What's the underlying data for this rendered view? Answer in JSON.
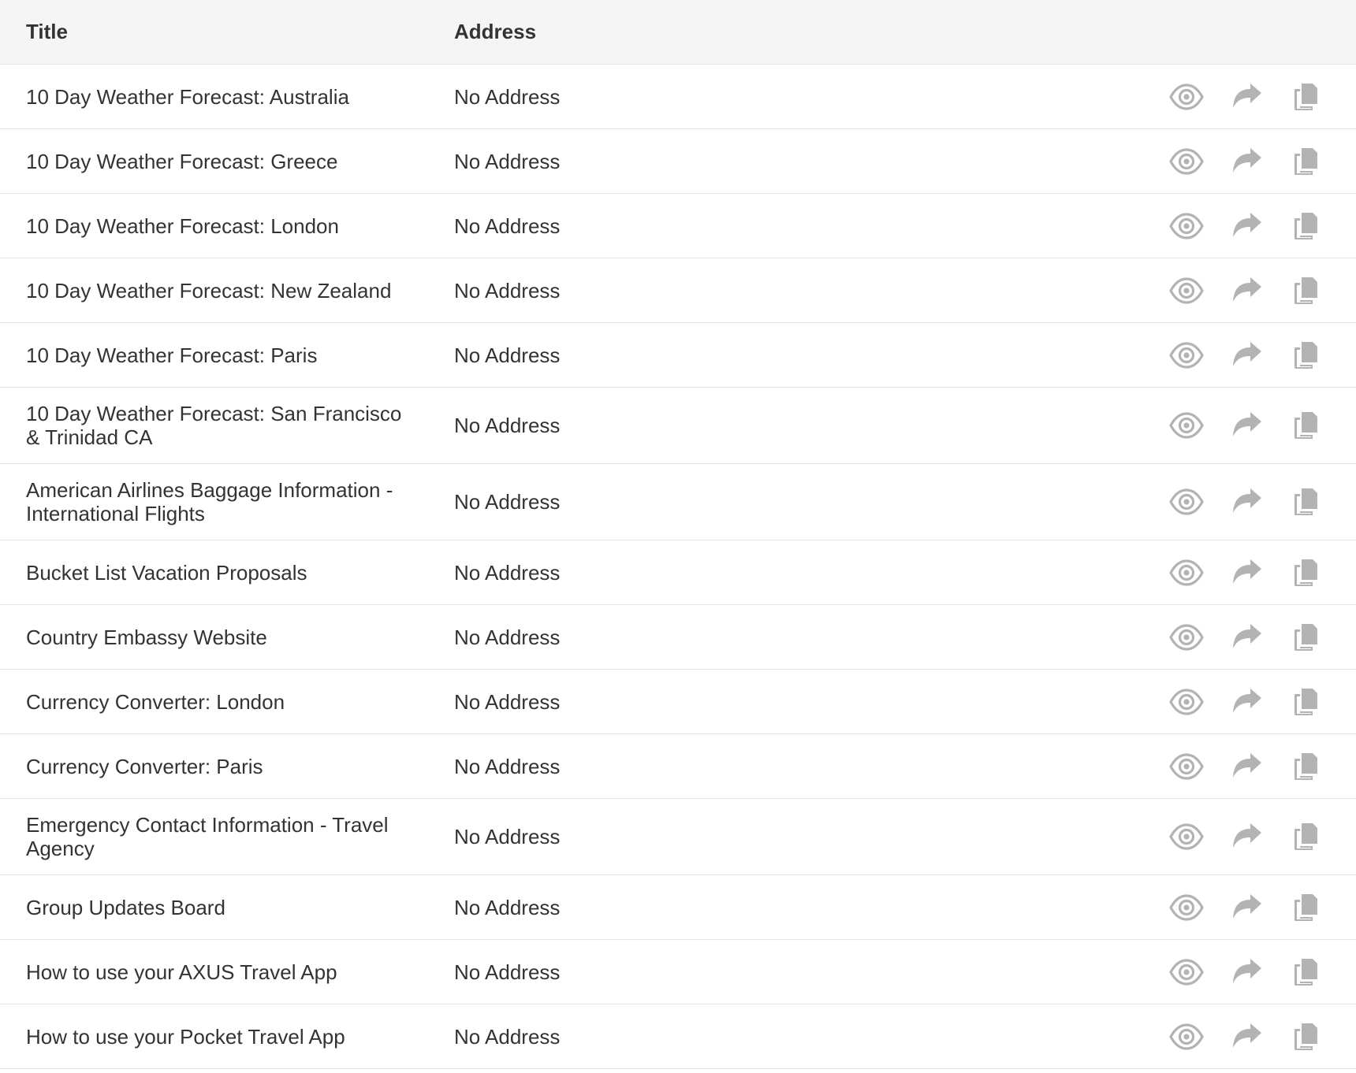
{
  "table": {
    "headers": {
      "title": "Title",
      "address": "Address"
    },
    "icon_color": "#b3b3b3",
    "row_actions": [
      "eye-icon",
      "share-icon",
      "copy-icon"
    ],
    "rows": [
      {
        "title": "10 Day Weather Forecast: Australia",
        "address": "No Address"
      },
      {
        "title": "10 Day Weather Forecast: Greece",
        "address": "No Address"
      },
      {
        "title": "10 Day Weather Forecast: London",
        "address": "No Address"
      },
      {
        "title": "10 Day Weather Forecast: New Zealand",
        "address": "No Address"
      },
      {
        "title": "10 Day Weather Forecast: Paris",
        "address": "No Address"
      },
      {
        "title": "10 Day Weather Forecast: San Francisco & Trinidad CA",
        "address": "No Address"
      },
      {
        "title": "American Airlines Baggage Information - International Flights",
        "address": "No Address"
      },
      {
        "title": "Bucket List Vacation Proposals",
        "address": "No Address"
      },
      {
        "title": "Country Embassy Website",
        "address": "No Address"
      },
      {
        "title": "Currency Converter: London",
        "address": "No Address"
      },
      {
        "title": "Currency Converter: Paris",
        "address": "No Address"
      },
      {
        "title": "Emergency Contact Information - Travel Agency",
        "address": "No Address"
      },
      {
        "title": "Group Updates Board",
        "address": "No Address"
      },
      {
        "title": "How to use your AXUS Travel App",
        "address": "No Address"
      },
      {
        "title": "How to use your Pocket Travel App",
        "address": "No Address"
      }
    ]
  }
}
